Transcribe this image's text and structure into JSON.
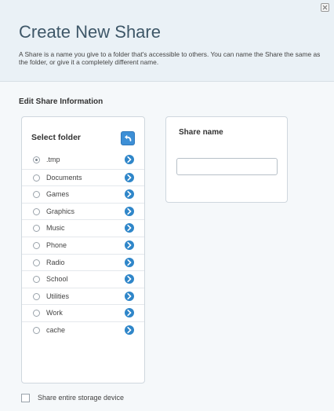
{
  "dialog": {
    "title": "Create New Share",
    "description": "A Share is a name you give to a folder that's accessible to others. You can name the Share the same as the folder, or give it a completely different name."
  },
  "section": {
    "title": "Edit Share Information"
  },
  "folder_panel": {
    "header": "Select folder",
    "back_icon": "back-arrow-icon",
    "items": [
      {
        "name": ".tmp",
        "selected": true
      },
      {
        "name": "Documents",
        "selected": false
      },
      {
        "name": "Games",
        "selected": false
      },
      {
        "name": "Graphics",
        "selected": false
      },
      {
        "name": "Music",
        "selected": false
      },
      {
        "name": "Phone",
        "selected": false
      },
      {
        "name": "Radio",
        "selected": false
      },
      {
        "name": "School",
        "selected": false
      },
      {
        "name": "Utilities",
        "selected": false
      },
      {
        "name": "Work",
        "selected": false
      },
      {
        "name": "cache",
        "selected": false
      }
    ]
  },
  "share_panel": {
    "label": "Share name",
    "value": ""
  },
  "options": {
    "share_entire_label": "Share entire storage device",
    "share_entire_checked": false
  },
  "colors": {
    "title": "#3e5768",
    "accent": "#2f86c9",
    "header_bg": "#eaf1f6"
  }
}
